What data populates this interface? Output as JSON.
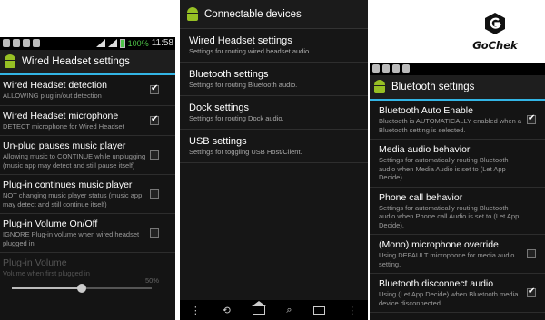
{
  "left": {
    "status": {
      "battery": "100%",
      "time": "11:58"
    },
    "title": "Wired Headset settings",
    "prefs": [
      {
        "title": "Wired Headset detection",
        "summary": "ALLOWING plug in/out detection",
        "checked": true
      },
      {
        "title": "Wired Headset microphone",
        "summary": "DETECT microphone for Wired Headset",
        "checked": true
      },
      {
        "title": "Un-plug pauses music player",
        "summary": "Allowing music to CONTINUE while unplugging (music app may detect and still pause itself)",
        "checked": false
      },
      {
        "title": "Plug-in continues music player",
        "summary": "NOT changing music player status (music app may detect and still continue itself)",
        "checked": false
      },
      {
        "title": "Plug-in Volume On/Off",
        "summary": "IGNORE Plug-in volume when wired headset plugged in",
        "checked": false
      }
    ],
    "volume": {
      "title": "Plug-in Volume",
      "summary": "Volume when first plugged in",
      "percent_label": "50%",
      "level": 0.5
    }
  },
  "middle": {
    "title": "Connectable devices",
    "devices": [
      {
        "title": "Wired Headset settings",
        "summary": "Settings for routing wired headset audio."
      },
      {
        "title": "Bluetooth settings",
        "summary": "Settings for routing Bluetooth audio."
      },
      {
        "title": "Dock settings",
        "summary": "Settings for routing Dock audio."
      },
      {
        "title": "USB settings",
        "summary": "Settings for toggling USB Host/Client."
      }
    ],
    "nav": {
      "back": "⟲",
      "search": "⌕",
      "menu": "⋮"
    }
  },
  "right": {
    "title": "Bluetooth settings",
    "prefs": [
      {
        "title": "Bluetooth Auto Enable",
        "summary": "Bluetooth is AUTOMATICALLY enabled when a Bluetooth setting is selected.",
        "checked": true,
        "has_check": true
      },
      {
        "title": "Media audio behavior",
        "summary": "Settings for automatically routing Bluetooth audio when Media Audio is set to (Let App Decide).",
        "has_check": false
      },
      {
        "title": "Phone call behavior",
        "summary": "Settings for automatically routing Bluetooth audio when Phone call Audio is set to (Let App Decide).",
        "has_check": false
      },
      {
        "title": "(Mono) microphone override",
        "summary": "Using DEFAULT microphone for media audio setting.",
        "checked": false,
        "has_check": true
      },
      {
        "title": "Bluetooth disconnect audio",
        "summary": "Using (Let App Decide) when Bluetooth media device disconnected.",
        "checked": true,
        "has_check": true
      }
    ]
  },
  "logo": {
    "text": "GoChek",
    "icon": "hex-g-icon"
  }
}
